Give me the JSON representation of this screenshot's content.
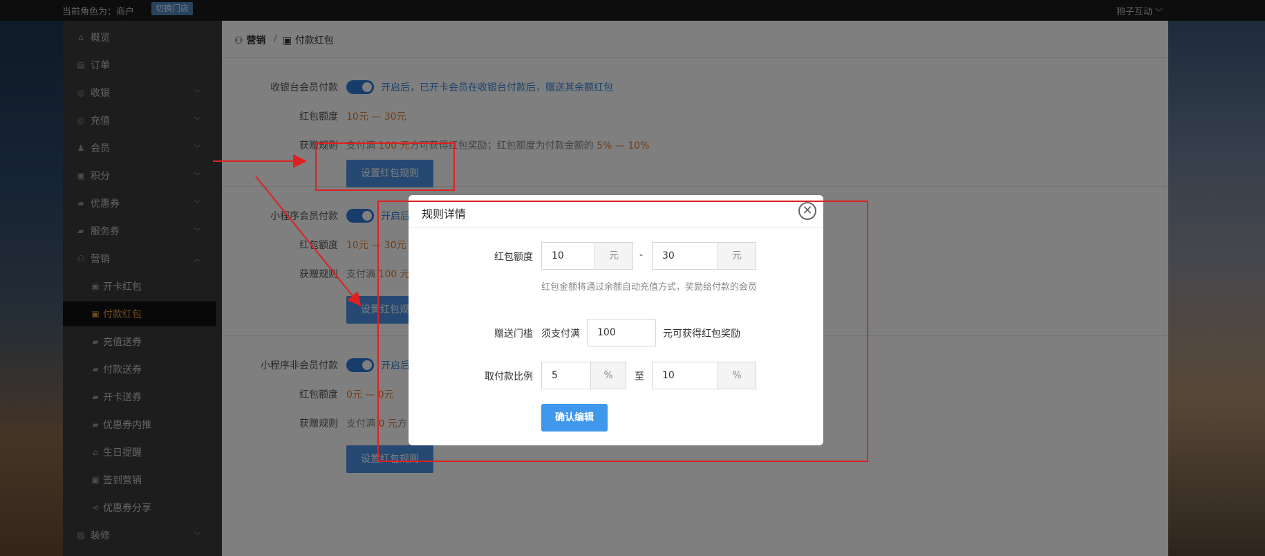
{
  "topbar": {
    "role_text": "当前角色为：商户",
    "switch_store": "切换门店",
    "user_name": "狍子互动",
    "user_chevron": "﹀"
  },
  "sidebar": {
    "items": [
      {
        "label": "概览",
        "icon": "home-icon",
        "glyph": "⌂",
        "has_arrow": false
      },
      {
        "label": "订单",
        "icon": "order-icon",
        "glyph": "▤",
        "has_arrow": false
      },
      {
        "label": "收银",
        "icon": "cashier-icon",
        "glyph": "◎",
        "has_arrow": true
      },
      {
        "label": "充值",
        "icon": "recharge-icon",
        "glyph": "◎",
        "has_arrow": true
      },
      {
        "label": "会员",
        "icon": "member-icon",
        "glyph": "♟",
        "has_arrow": true
      },
      {
        "label": "积分",
        "icon": "points-icon",
        "glyph": "▣",
        "has_arrow": true
      },
      {
        "label": "优惠券",
        "icon": "coupon-icon",
        "glyph": "▰",
        "has_arrow": true
      },
      {
        "label": "服务券",
        "icon": "service-coupon-icon",
        "glyph": "▰",
        "has_arrow": true
      },
      {
        "label": "营销",
        "icon": "marketing-icon",
        "glyph": "⚇",
        "has_arrow": true
      },
      {
        "label": "开卡红包",
        "icon": "gift-icon",
        "glyph": "▣",
        "sub": true
      },
      {
        "label": "付款红包",
        "icon": "gift-icon",
        "glyph": "▣",
        "sub": true,
        "active": true
      },
      {
        "label": "充值送券",
        "icon": "ticket-icon",
        "glyph": "▰",
        "sub": true
      },
      {
        "label": "付款送券",
        "icon": "ticket-icon",
        "glyph": "▰",
        "sub": true
      },
      {
        "label": "开卡送券",
        "icon": "ticket-icon",
        "glyph": "▰",
        "sub": true
      },
      {
        "label": "优惠券内推",
        "icon": "ticket-icon",
        "glyph": "▰",
        "sub": true
      },
      {
        "label": "生日提醒",
        "icon": "cake-icon",
        "glyph": "⌂",
        "sub": true
      },
      {
        "label": "签到营销",
        "icon": "checkin-icon",
        "glyph": "▣",
        "sub": true
      },
      {
        "label": "优惠券分享",
        "icon": "share-icon",
        "glyph": "⋖",
        "sub": true
      },
      {
        "label": "装修",
        "icon": "decorate-icon",
        "glyph": "▨",
        "has_arrow": true
      }
    ],
    "arrow_down": "﹀",
    "arrow_up": "︿"
  },
  "breadcrumb": {
    "level1": "营销",
    "separator": "/",
    "level2": "付款红包",
    "level1_icon": "⚇",
    "level2_icon": "▣"
  },
  "sections": [
    {
      "label": "收银台会员付款",
      "toggle_on": true,
      "toggle_note": "开启后，已开卡会员在收银台付款后，赠送其余额红包",
      "amount_label": "红包额度",
      "amount_value": "10元 — 30元",
      "rule_label": "获赠规则",
      "rule_prefix": "支付满",
      "rule_threshold": "100 元",
      "rule_middle": "方可获得红包奖励；红包额度为付款金额的",
      "rule_ratio": "5% — 10%",
      "button": "设置红包规则"
    },
    {
      "label": "小程序会员付款",
      "toggle_on": true,
      "toggle_note": "开启后",
      "amount_label": "红包额度",
      "amount_value": "10元 — 30元",
      "rule_label": "获赠规则",
      "rule_prefix": "支付满",
      "rule_threshold": "100 元",
      "button": "设置红包规则"
    },
    {
      "label": "小程序非会员付款",
      "toggle_on": true,
      "toggle_note": "开启后",
      "amount_label": "红包额度",
      "amount_value": "0元 — 0元",
      "rule_label": "获赠规则",
      "rule_prefix": "支付满",
      "rule_threshold": "0 元",
      "rule_middle": "方",
      "button": "设置红包规则"
    }
  ],
  "modal": {
    "title": "规则详情",
    "close_glyph": "✕",
    "amount_label": "红包额度",
    "amount_min": "10",
    "amount_max": "30",
    "unit_yuan": "元",
    "dash": "-",
    "amount_hint": "红包金额将通过余额自动充值方式，奖励给付款的会员",
    "threshold_label": "赠送门槛",
    "threshold_prefix": "须支付满",
    "threshold_value": "100",
    "threshold_suffix": "元可获得红包奖励",
    "ratio_label": "取付款比例",
    "ratio_min": "5",
    "ratio_max": "10",
    "unit_percent": "%",
    "ratio_to": "至",
    "confirm_button": "确认编辑"
  },
  "colors": {
    "accent_blue": "#4a92e4",
    "highlight_orange": "#e07a2e",
    "annotation_red": "#e02020"
  }
}
